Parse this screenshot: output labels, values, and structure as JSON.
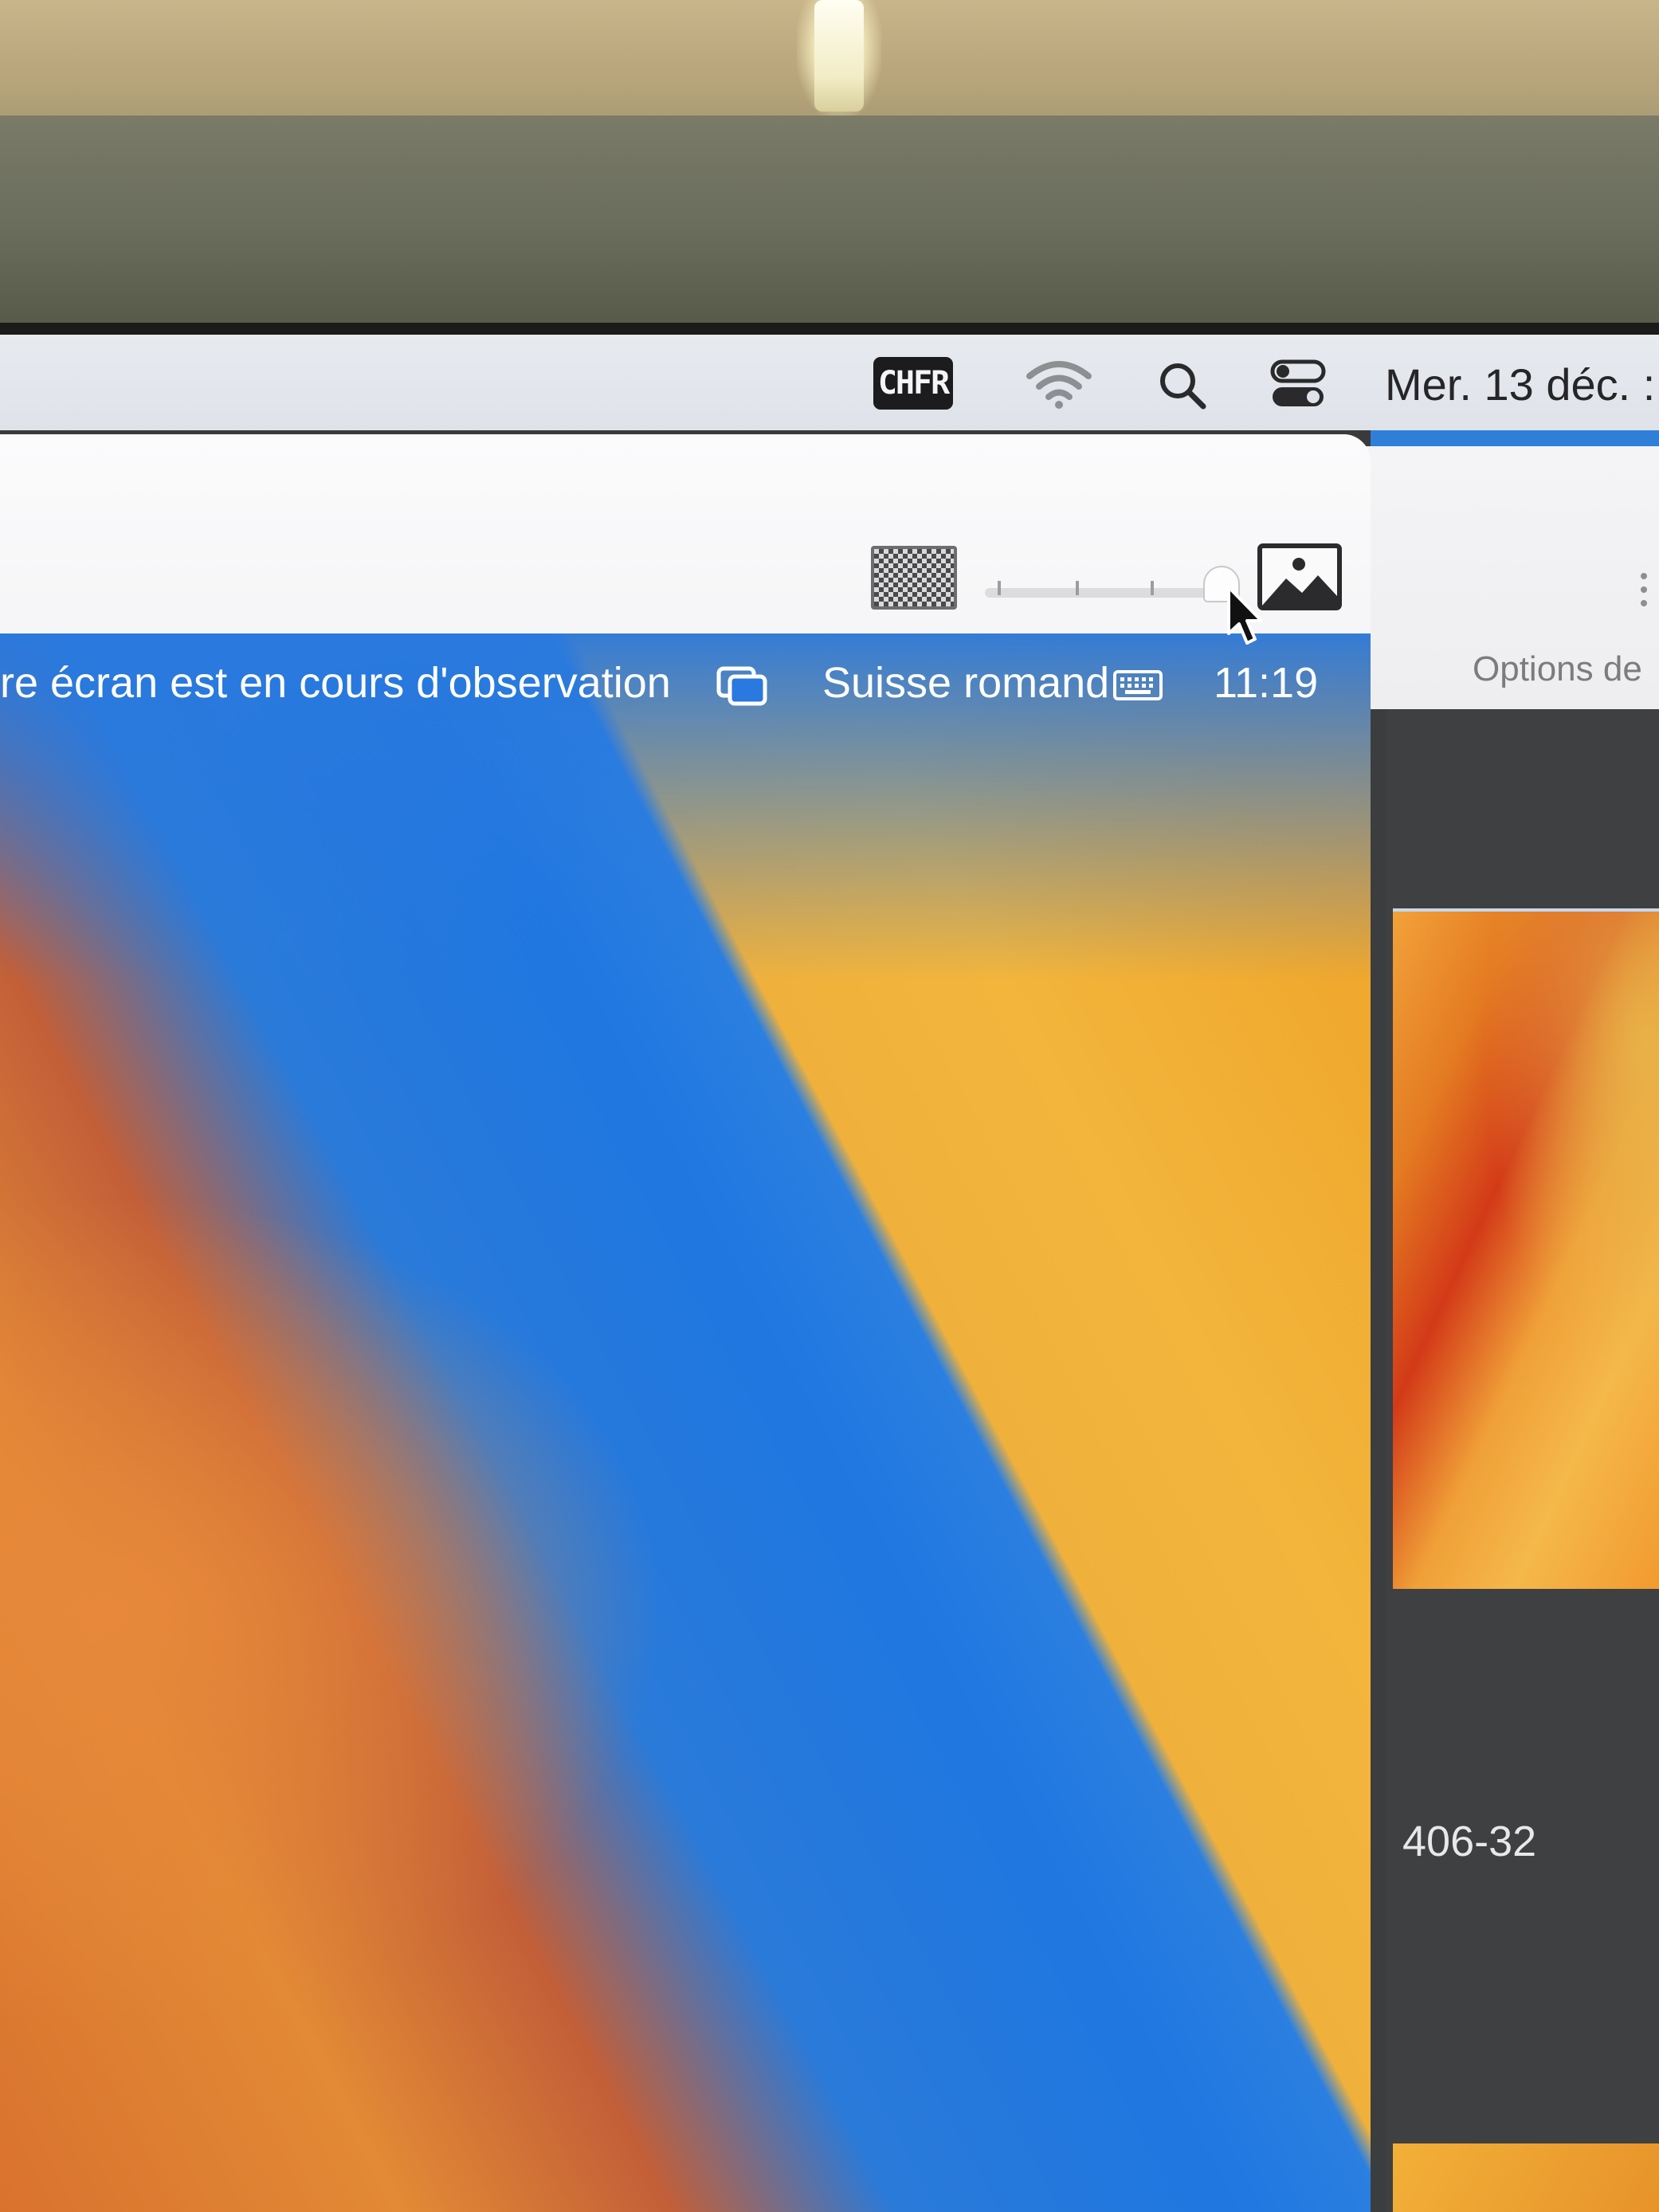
{
  "menubar": {
    "input_source": "CHFR",
    "date": "Mer. 13 déc. :",
    "icons": [
      "wifi-icon",
      "search-icon",
      "control-center-icon"
    ]
  },
  "viewer_window": {
    "toolbar": {
      "icons": [
        "checkerboard-icon",
        "image-icon"
      ],
      "quality_slider": {
        "level": 1.0,
        "ticks": 4
      }
    },
    "remote_menubar": {
      "observation_text": "re écran est en cours d'observation",
      "keyboard_layout": "Suisse romand",
      "time": "11:19",
      "icons": [
        "screens-icon",
        "keyboard-icon"
      ]
    }
  },
  "background_window": {
    "options_label": "Options de",
    "item_label": "406-32"
  },
  "colors": {
    "accent_blue": "#1f77e0",
    "wallpaper_orange": "#f0a92f"
  }
}
